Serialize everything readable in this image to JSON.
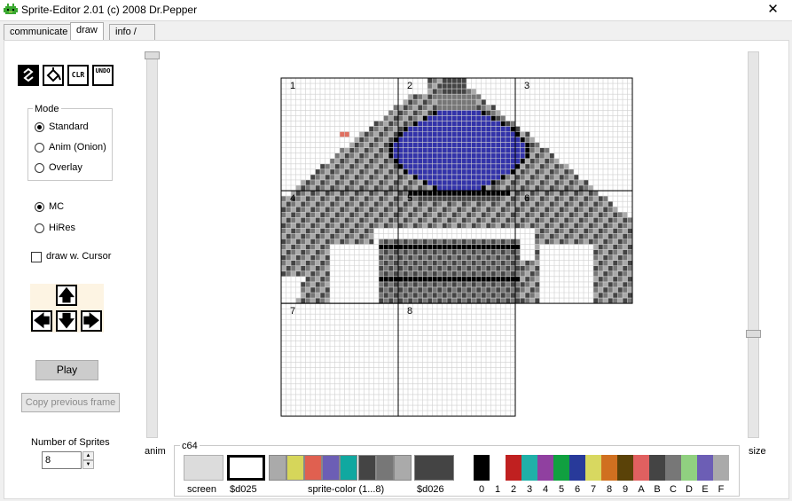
{
  "window": {
    "title": "Sprite-Editor 2.01 (c) 2008 Dr.Pepper",
    "close_glyph": "✕"
  },
  "tabs": [
    {
      "label": "communicate",
      "active": false
    },
    {
      "label": "draw",
      "active": true
    },
    {
      "label": "info / settings",
      "active": false
    }
  ],
  "tools": [
    {
      "icon": "pen-icon",
      "glyph": "~",
      "active": true
    },
    {
      "icon": "fill-bucket-icon",
      "glyph": "◭",
      "active": false
    },
    {
      "icon": "clear-icon",
      "glyph": "CLR",
      "active": false
    },
    {
      "icon": "undo-icon",
      "glyph": "UNDO",
      "active": false
    }
  ],
  "mode": {
    "legend": "Mode",
    "options": [
      {
        "label": "Standard",
        "selected": true
      },
      {
        "label": "Anim (Onion)",
        "selected": false
      },
      {
        "label": "Overlay",
        "selected": false
      }
    ]
  },
  "resolution": {
    "options": [
      {
        "label": "MC",
        "selected": true
      },
      {
        "label": "HiRes",
        "selected": false
      }
    ]
  },
  "draw_with_cursor": {
    "label": "draw w. Cursor",
    "checked": false
  },
  "arrows": {
    "up": "🡅",
    "left": "🡄",
    "down": "🡇",
    "right": "🡆"
  },
  "play_label": "Play",
  "copy_label": "Copy previous frame",
  "num_sprites": {
    "label": "Number of Sprites",
    "value": "8"
  },
  "sliders": {
    "anim_label": "anim",
    "size_label": "size"
  },
  "sprites": {
    "labels": [
      "1",
      "2",
      "3",
      "4",
      "5",
      "6",
      "7",
      "8"
    ],
    "colors": {
      "bg": "#ffffff",
      "light": "#aaaaaa",
      "mid": "#777777",
      "dark": "#444444",
      "blue": "#3333aa",
      "black": "#000000",
      "grid": "#cfcfcf",
      "red": "#e07060"
    }
  },
  "palette": {
    "legend": "c64",
    "screen_label": "screen",
    "screen_color": "#dcdcdc",
    "d025_label": "$d025",
    "d025_color": "#ffffff",
    "sprite_label": "sprite-color (1...8)",
    "sprite_colors": [
      "#aaaaaa",
      "#d6d65a",
      "#e06050",
      "#6c5eb5",
      "#10a8a0",
      "#444444",
      "#777777",
      "#aaaaaa"
    ],
    "d026_label": "$d026",
    "d026_color": "#444444",
    "c64_colors": [
      "#000000",
      "#ffffff",
      "#c02020",
      "#20b0a8",
      "#9040a0",
      "#10a040",
      "#283a9a",
      "#d8d860",
      "#d07020",
      "#5a4208",
      "#e06060",
      "#444444",
      "#777777",
      "#90d080",
      "#6c5eb5",
      "#aaaaaa"
    ],
    "c64_labels": [
      "0",
      "1",
      "2",
      "3",
      "4",
      "5",
      "6",
      "7",
      "8",
      "9",
      "A",
      "B",
      "C",
      "D",
      "E",
      "F"
    ]
  }
}
